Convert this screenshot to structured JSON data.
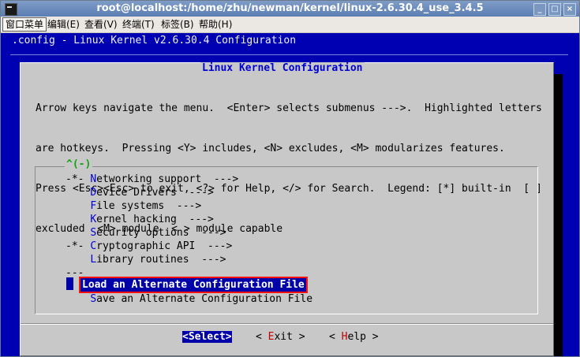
{
  "window": {
    "title": "root@localhost:/home/zhu/newman/kernel/linux-2.6.30.4_use_3.4.5",
    "controls": [
      "_",
      "□",
      "×"
    ]
  },
  "menubar": [
    "窗口菜单",
    "编辑(E)",
    "查看(V)",
    "终端(T)",
    "标签(B)",
    "帮助(H)"
  ],
  "terminal": {
    "header": ".config - Linux Kernel v2.6.30.4 Configuration"
  },
  "dialog": {
    "title": "Linux Kernel Configuration",
    "help": [
      "Arrow keys navigate the menu.  <Enter> selects submenus --->.  Highlighted letters",
      "are hotkeys.  Pressing <Y> includes, <N> excludes, <M> modularizes features.",
      "Press <Esc><Esc> to exit, <?> for Help, </> for Search.  Legend: [*] built-in  [ ]",
      "excluded  <M> module  < > module capable"
    ],
    "scroll_indicator": "^(-)",
    "entries": [
      {
        "prefix": "-*- ",
        "hotkey": "N",
        "rest": "etworking support  --->"
      },
      {
        "prefix": "    ",
        "hotkey": "D",
        "rest": "evice Drivers  --->"
      },
      {
        "prefix": "    ",
        "hotkey": "F",
        "rest": "ile systems  --->"
      },
      {
        "prefix": "    ",
        "hotkey": "K",
        "rest": "ernel hacking  --->"
      },
      {
        "prefix": "    ",
        "hotkey": "S",
        "rest": "ecurity options  --->"
      },
      {
        "prefix": "-*- ",
        "hotkey": "C",
        "rest": "ryptographic API  --->"
      },
      {
        "prefix": "    ",
        "hotkey": "L",
        "rest": "ibrary routines  --->"
      },
      {
        "prefix": "---",
        "hotkey": "",
        "rest": ""
      },
      {
        "prefix": "",
        "hotkey": "L",
        "rest": "oad an Alternate Configuration File"
      },
      {
        "prefix": "    ",
        "hotkey": "S",
        "rest": "ave an Alternate Configuration File"
      }
    ],
    "buttons": {
      "select": "<Select>",
      "exit_pre": "< ",
      "exit_hotkey": "E",
      "exit_post": "xit >",
      "help_pre": "< ",
      "help_hotkey": "H",
      "help_post": "elp >"
    }
  }
}
